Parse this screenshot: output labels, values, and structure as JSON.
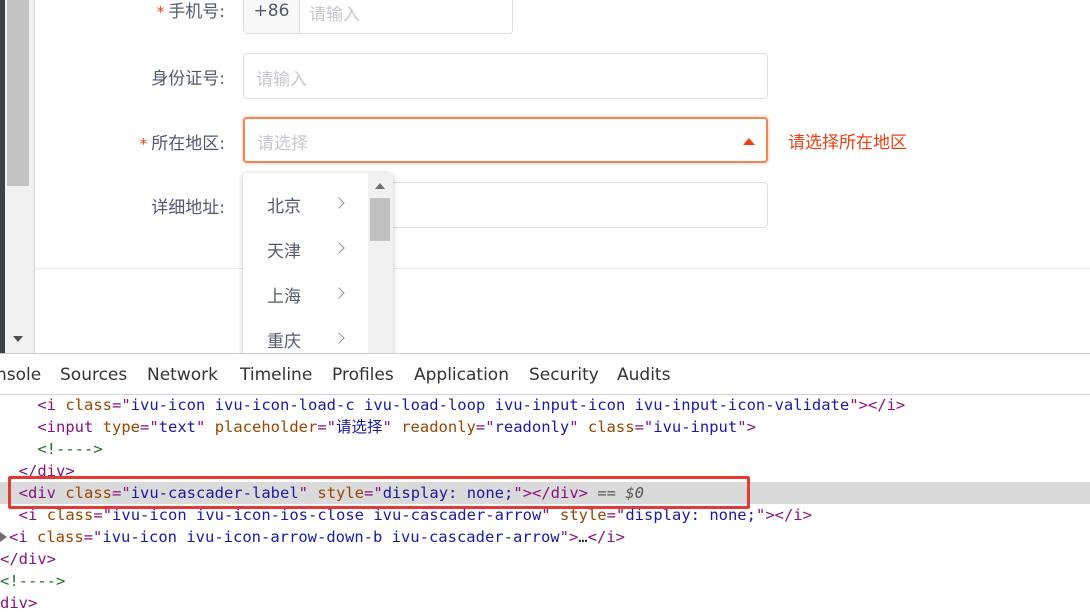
{
  "form": {
    "phone": {
      "required_mark": "*",
      "label": "手机号:",
      "prefix": "+86",
      "placeholder": "请输入"
    },
    "idcard": {
      "label": "身份证号:",
      "placeholder": "请输入"
    },
    "region": {
      "required_mark": "*",
      "label": "所在地区:",
      "placeholder": "请选择",
      "error": "请选择所在地区"
    },
    "detail": {
      "label": "详细地址:"
    }
  },
  "dropdown": {
    "items": [
      "北京",
      "天津",
      "上海",
      "重庆"
    ]
  },
  "devtools": {
    "tabs": [
      "nsole",
      "Sources",
      "Network",
      "Timeline",
      "Profiles",
      "Application",
      "Security",
      "Audits"
    ],
    "dom_selected_suffix": " == $0"
  },
  "colors": {
    "error": "#ed4014",
    "focus_border": "#f0854f",
    "selection_box": "#e53935"
  }
}
